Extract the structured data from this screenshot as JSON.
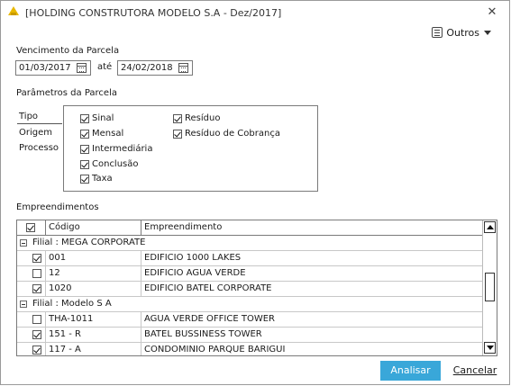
{
  "window": {
    "title": "[HOLDING CONSTRUTORA MODELO S.A - Dez/2017]",
    "close_glyph": "✕"
  },
  "toolbar": {
    "outros_label": "Outros"
  },
  "vencimento": {
    "section_label": "Vencimento da Parcela",
    "from_value": "01/03/2017",
    "ate_label": "até",
    "to_value": "24/02/2018"
  },
  "parametros": {
    "section_label": "Parâmetros da Parcela",
    "tabs": [
      {
        "label": "Tipo",
        "active": true
      },
      {
        "label": "Origem",
        "active": false
      },
      {
        "label": "Processo",
        "active": false
      }
    ],
    "options_col1": [
      {
        "label": "Sinal",
        "checked": true
      },
      {
        "label": "Mensal",
        "checked": true
      },
      {
        "label": "Intermediária",
        "checked": true
      },
      {
        "label": "Conclusão",
        "checked": true
      },
      {
        "label": "Taxa",
        "checked": true
      }
    ],
    "options_col2": [
      {
        "label": "Resíduo",
        "checked": true
      },
      {
        "label": "Resíduo de Cobrança",
        "checked": true
      }
    ]
  },
  "empreendimentos": {
    "section_label": "Empreendimentos",
    "columns": {
      "codigo": "Código",
      "empreendimento": "Empreendimento"
    },
    "groups": [
      {
        "label": "Filial : MEGA CORPORATE",
        "rows": [
          {
            "checked": true,
            "codigo": "001",
            "nome": "EDIFICIO 1000 LAKES"
          },
          {
            "checked": false,
            "codigo": "12",
            "nome": "EDIFICIO AGUA VERDE"
          },
          {
            "checked": true,
            "codigo": "1020",
            "nome": "EDIFICIO BATEL CORPORATE"
          }
        ]
      },
      {
        "label": "Filial : Modelo S A",
        "rows": [
          {
            "checked": false,
            "codigo": "THA-1011",
            "nome": "AGUA VERDE OFFICE TOWER"
          },
          {
            "checked": true,
            "codigo": "151 - R",
            "nome": "BATEL BUSSINESS TOWER"
          },
          {
            "checked": true,
            "codigo": "117 - A",
            "nome": "CONDOMINIO PARQUE BARIGUI"
          }
        ]
      }
    ]
  },
  "actions": {
    "analisar_label": "Analisar",
    "cancelar_label": "Cancelar"
  },
  "colors": {
    "primary_button": "#39a7d9",
    "app_icon": "#e8b800"
  }
}
